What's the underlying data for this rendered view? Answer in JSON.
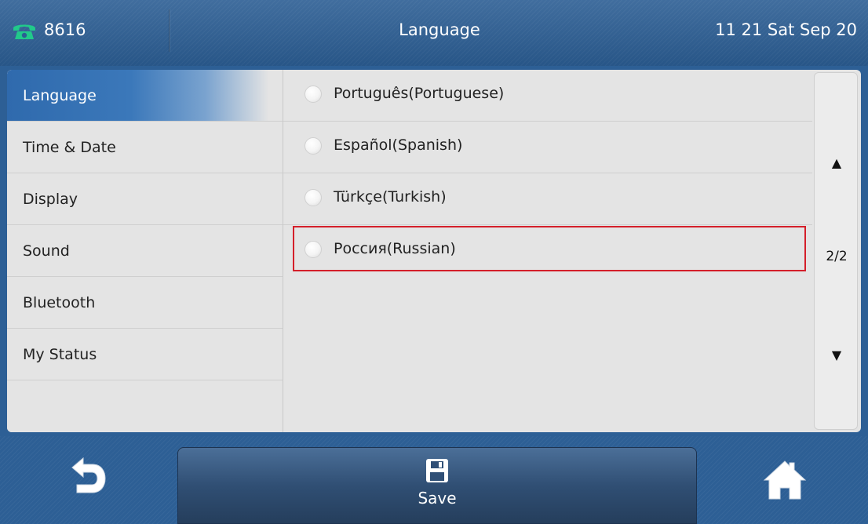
{
  "statusbar": {
    "account": "8616",
    "title": "Language",
    "time": "11 21 Sat Sep 20",
    "icon": "phone-icon"
  },
  "sidebar": {
    "items": [
      {
        "label": "Language",
        "active": true
      },
      {
        "label": "Time & Date",
        "active": false
      },
      {
        "label": "Display",
        "active": false
      },
      {
        "label": "Sound",
        "active": false
      },
      {
        "label": "Bluetooth",
        "active": false
      },
      {
        "label": "My Status",
        "active": false
      }
    ]
  },
  "languages": {
    "items": [
      {
        "label": "Português(Portuguese)",
        "selected": false
      },
      {
        "label": "Español(Spanish)",
        "selected": false
      },
      {
        "label": "Türkçe(Turkish)",
        "selected": false
      },
      {
        "label": "Россия(Russian)",
        "selected": false,
        "highlighted": true
      }
    ]
  },
  "scroll": {
    "up_glyph": "▲",
    "down_glyph": "▼",
    "page": "2/2"
  },
  "softkeys": {
    "back_icon": "back-arrow-icon",
    "save_label": "Save",
    "save_icon": "floppy-disk-icon",
    "home_icon": "home-icon"
  },
  "colors": {
    "accent": "#2f6aad",
    "highlight_border": "#d41f2a",
    "phone_icon": "#21c98a"
  }
}
